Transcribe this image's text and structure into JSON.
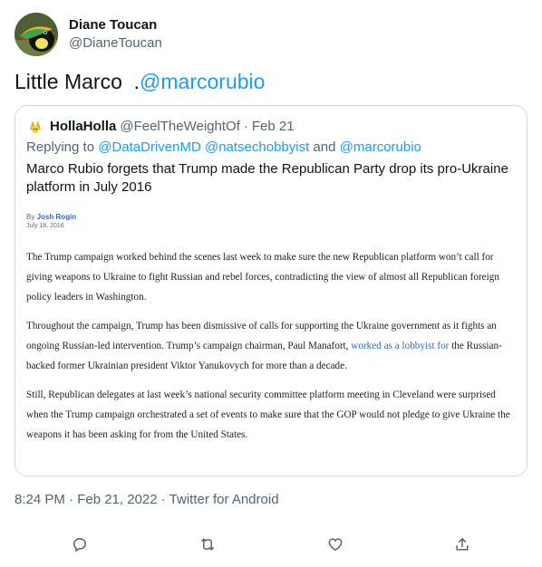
{
  "author": {
    "display_name": "Diane Toucan",
    "handle": "@DianeToucan"
  },
  "tweet": {
    "text_prefix": "Little Marco  .",
    "mention": "@marcorubio"
  },
  "quoted": {
    "display_name": "HollaHolla",
    "handle": "@FeelTheWeightOf",
    "separator": "·",
    "date": "Feb 21",
    "reply_prefix": "Replying to ",
    "reply_mentions": "@DataDrivenMD @natsechobbyist",
    "reply_and": " and ",
    "reply_last": "@marcorubio",
    "text": "Marco Rubio forgets that Trump made the Republican Party drop its pro-Ukraine platform in July 2016",
    "article": {
      "by_prefix": "By ",
      "author": "Josh Rogin",
      "date": "July 18, 2016",
      "para1": "The Trump campaign worked behind the scenes last week to make sure the new Republican platform won’t call for giving weapons to Ukraine to fight Russian and rebel forces, contradicting the view of almost all Republican foreign policy leaders in Washington.",
      "para2_before": "Throughout the campaign, Trump has been dismissive of calls for supporting the Ukraine government as it fights an ongoing Russian-led intervention. Trump’s campaign chairman, Paul Manafort, ",
      "para2_link": "worked as a lobbyist for",
      "para2_after": " the Russian-backed former Ukrainian president Viktor Yanukovych for more than a decade.",
      "para3": "Still, Republican delegates at last week’s national security committee platform meeting in Cleveland were surprised when the Trump campaign orchestrated a set of events to make sure that the GOP would not pledge to give Ukraine the weapons it has been asking for from the United States."
    }
  },
  "meta": {
    "text": "8:24 PM · Feb 21, 2022 · Twitter for Android"
  },
  "actions": {
    "reply_icon": "reply-icon",
    "retweet_icon": "retweet-icon",
    "like_icon": "heart-icon",
    "share_icon": "share-icon"
  },
  "colors": {
    "link": "#1d9bf0",
    "secondary_text": "#536471",
    "border": "#cfd9de",
    "article_link": "#2a6ebb"
  }
}
